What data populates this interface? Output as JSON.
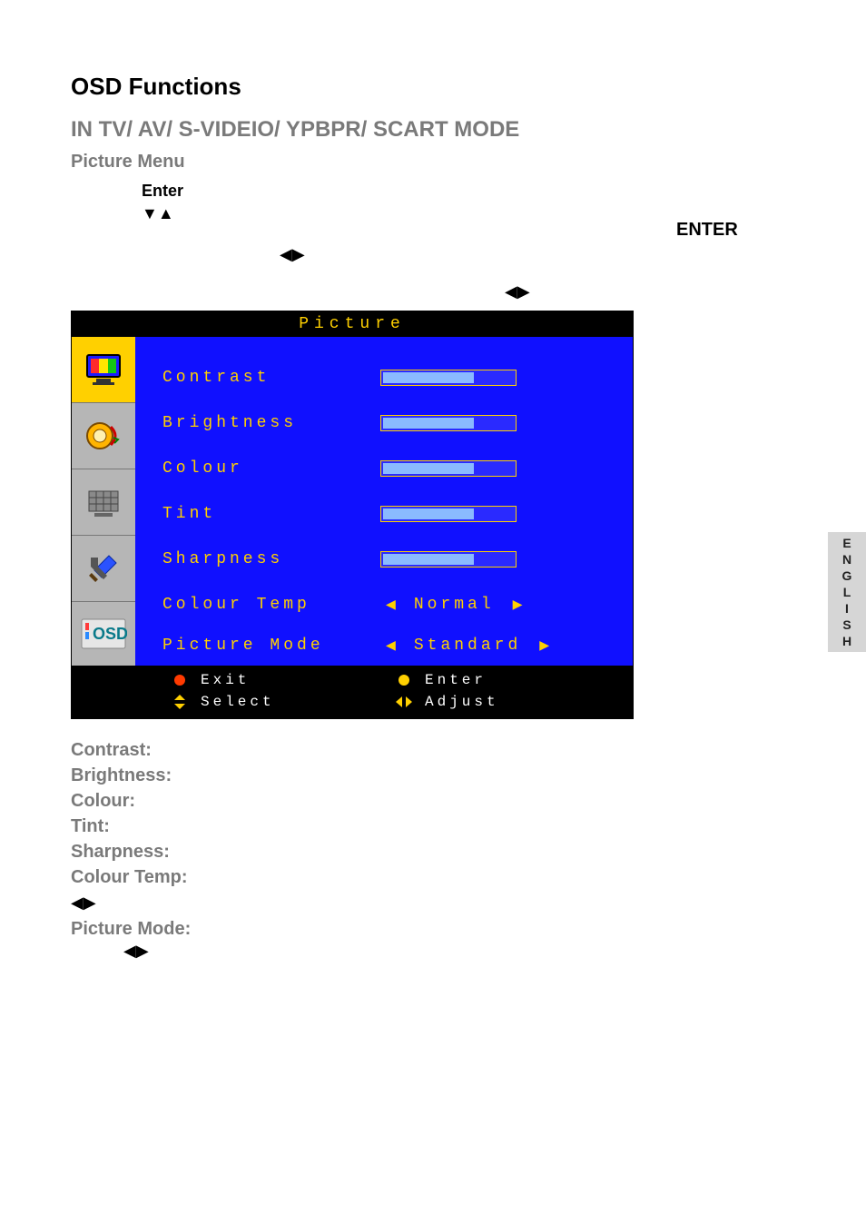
{
  "headings": {
    "h1": "OSD Functions",
    "h2": "IN TV/ AV/ S-VIDEIO/ YPBPR/ SCART MODE",
    "h3": "Picture Menu",
    "enter": "Enter",
    "enter_right": "ENTER"
  },
  "osd": {
    "title": "Picture",
    "rows": {
      "contrast": "Contrast",
      "brightness": "Brightness",
      "colour": "Colour",
      "tint": "Tint",
      "sharpness": "Sharpness",
      "colour_temp_label": "Colour Temp",
      "colour_temp_value": "Normal",
      "picture_mode_label": "Picture Mode",
      "picture_mode_value": "Standard"
    },
    "footer": {
      "exit": "Exit",
      "enter": "Enter",
      "select": "Select",
      "adjust": "Adjust"
    }
  },
  "below": {
    "contrast": "Contrast:",
    "brightness": "Brightness:",
    "colour": "Colour:",
    "tint": "Tint:",
    "sharpness": "Sharpness:",
    "colour_temp": "Colour Temp:",
    "picture_mode": "Picture Mode:"
  },
  "side_tab": "ENGLISH"
}
